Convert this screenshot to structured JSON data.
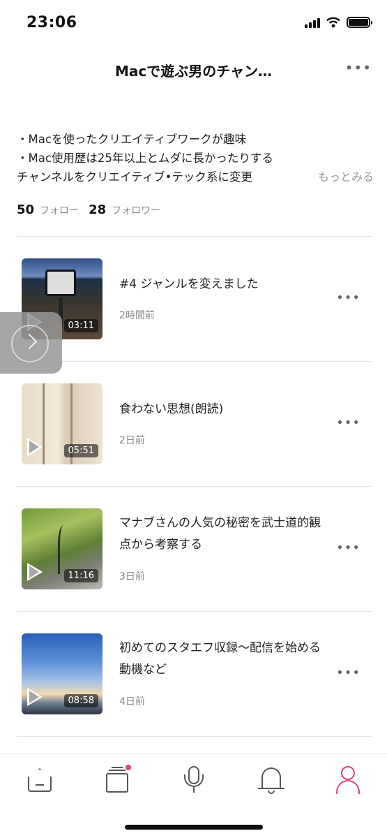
{
  "status_bar": {
    "time": "23:06"
  },
  "header": {
    "title": "Macで遊ぶ男のチャン…",
    "more_label": "•••"
  },
  "bio": {
    "lines": [
      "・Macを使ったクリエイティブワークが趣味",
      "・Mac使用歴は25年以上とムダに長かったりする",
      "チャンネルをクリエイティブ•テック系に変更"
    ],
    "more_link": "もっとみる"
  },
  "stats": {
    "following_count": "50",
    "following_label": "フォロー",
    "followers_count": "28",
    "followers_label": "フォロワー"
  },
  "episodes": [
    {
      "title": "#4 ジャンルを変えました",
      "date": "2時間前",
      "duration": "03:11",
      "more": "•••"
    },
    {
      "title": "食わない思想(朗読)",
      "date": "2日前",
      "duration": "05:51",
      "more": "•••"
    },
    {
      "title": "マナブさんの人気の秘密を武士道的観点から考察する",
      "date": "3日前",
      "duration": "11:16",
      "more": "•••"
    },
    {
      "title": "初めてのスタエフ収録〜配信を始める動機など",
      "date": "4日前",
      "duration": "08:58",
      "more": "•••"
    }
  ],
  "tabbar": {
    "items": [
      "home-icon",
      "library-icon",
      "mic-icon",
      "bell-icon",
      "profile-icon"
    ],
    "active": "profile-icon",
    "accent_color": "#d9467a"
  }
}
